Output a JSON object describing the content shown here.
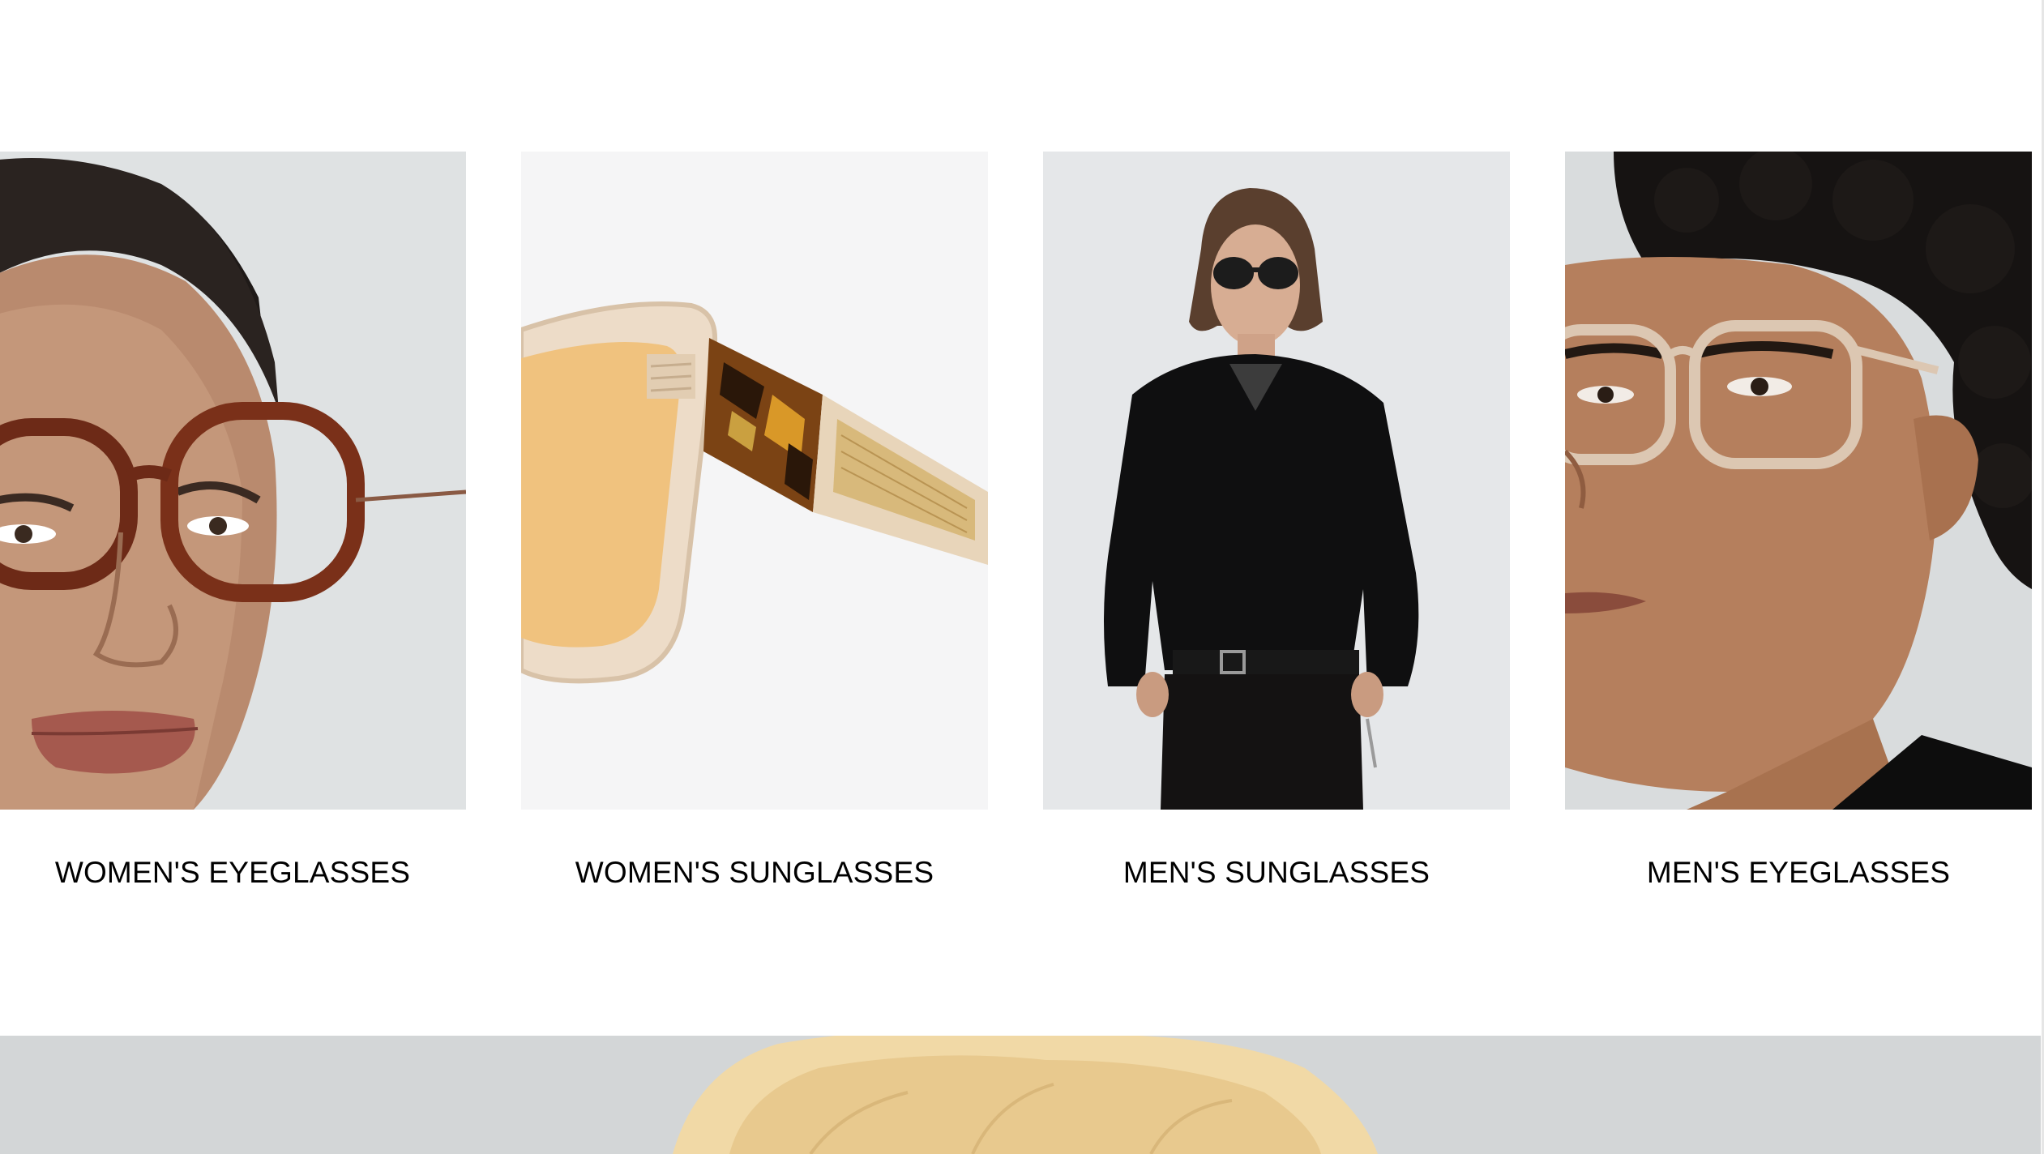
{
  "categories": [
    {
      "label": "WOMEN'S EYEGLASSES",
      "image": "woman-wearing-tortoise-round-eyeglasses"
    },
    {
      "label": "WOMEN'S SUNGLASSES",
      "image": "translucent-cat-eye-sunglasses-closeup"
    },
    {
      "label": "MEN'S SUNGLASSES",
      "image": "man-in-black-sweater-with-sunglasses"
    },
    {
      "label": "MEN'S EYEGLASSES",
      "image": "man-wearing-clear-frame-eyeglasses"
    }
  ],
  "hero": {
    "image": "blonde-model-portrait"
  },
  "colors": {
    "background": "#ffffff",
    "text": "#000000",
    "hero_bg": "#d3d6d7"
  }
}
